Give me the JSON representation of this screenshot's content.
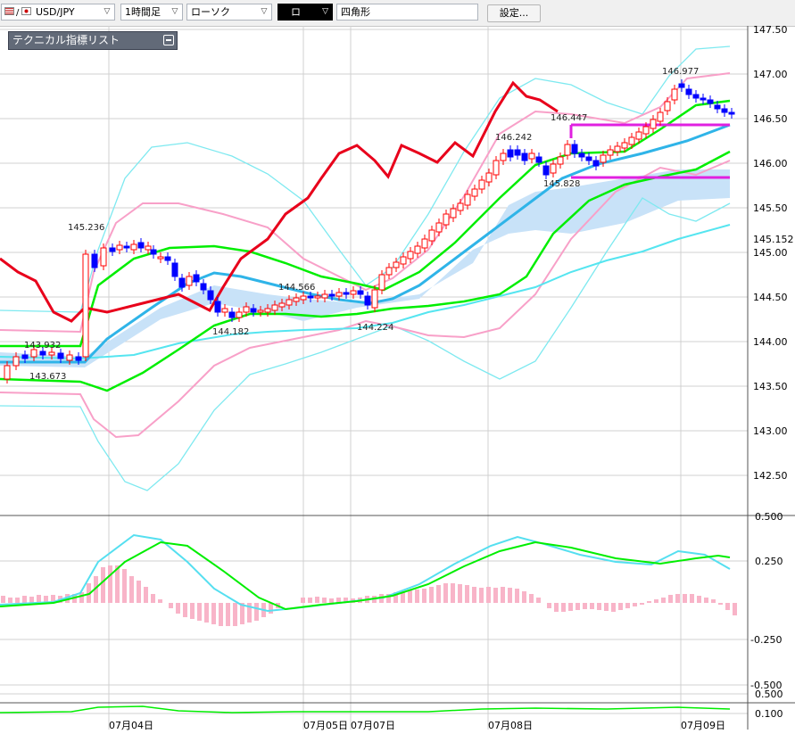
{
  "toolbar": {
    "symbol": "USD/JPY",
    "interval": "1時間足",
    "chart_type": "ローソク",
    "color_label": "ロ",
    "drawing_tool": "四角形",
    "settings_label": "設定..."
  },
  "panel": {
    "title": "テクニカル指標リスト"
  },
  "price_axis": {
    "ticks": [
      "147.50",
      "147.00",
      "146.50",
      "146.00",
      "145.50",
      "145.00",
      "144.50",
      "144.00",
      "143.50",
      "143.00",
      "142.50"
    ],
    "current_price": "145.152"
  },
  "indicator_axis": {
    "ticks": [
      "0.500",
      "0.250",
      "-0.250",
      "-0.500"
    ]
  },
  "bottom_axis": {
    "ticks": [
      "0.500",
      "0.100"
    ]
  },
  "time_axis": {
    "ticks": [
      "07月04日",
      "07月05日",
      "07月07日",
      "07月08日",
      "07月09日"
    ]
  },
  "annotations": {
    "high_1": "145.236",
    "low_1": "143.673",
    "mid_1": "143.932",
    "low_2": "144.182",
    "mid_2": "144.566",
    "low_3": "144.224",
    "high_2": "146.242",
    "high_3": "146.447",
    "low_4": "145.828",
    "high_4": "146.977"
  },
  "colors": {
    "up_candle": "#ff0000",
    "down_candle": "#0000ff",
    "ma_red": "#e8001b",
    "ma_green": "#00ee00",
    "ma_blue": "#2fb4e8",
    "band_pink": "#f8a0c8",
    "band_cyan": "#7ee9f0",
    "cloud": "#c8e2f8",
    "rect_magenta": "#e020e0"
  }
}
